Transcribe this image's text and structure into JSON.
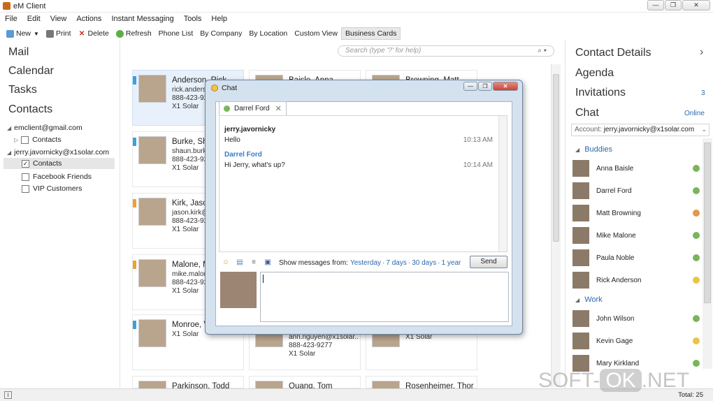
{
  "window": {
    "title": "eM Client",
    "min": "—",
    "max": "❐",
    "close": "✕"
  },
  "menu": [
    "File",
    "Edit",
    "View",
    "Actions",
    "Instant Messaging",
    "Tools",
    "Help"
  ],
  "toolbar": {
    "new": "New",
    "print": "Print",
    "delete": "Delete",
    "refresh": "Refresh",
    "views": [
      "Phone List",
      "By Company",
      "By Location",
      "Custom View",
      "Business Cards"
    ],
    "active_view": "Business Cards"
  },
  "nav": {
    "sections": [
      "Mail",
      "Calendar",
      "Tasks",
      "Contacts"
    ],
    "accounts": [
      {
        "name": "emclient@gmail.com",
        "folders": [
          "Contacts"
        ]
      },
      {
        "name": "jerry.javornicky@x1solar.com",
        "folders": [
          "Contacts",
          "Facebook Friends",
          "VIP Customers"
        ]
      }
    ]
  },
  "search": {
    "placeholder": "Search (type '?' for help)"
  },
  "cards": [
    {
      "name": "Anderson, Rick",
      "email": "rick.anderson@x1solar.com",
      "phone": "888-423-9277",
      "company": "X1 Solar",
      "bar": "#3aa0e0"
    },
    {
      "name": "Baisle, Anna",
      "email": "",
      "phone": "",
      "company": "",
      "bar": ""
    },
    {
      "name": "Browning, Matt",
      "email": "",
      "phone": "",
      "company": "",
      "bar": ""
    },
    {
      "name": "Burke, Shaun",
      "email": "shaun.burke@x1solar.com",
      "phone": "888-423-9277",
      "company": "X1 Solar",
      "bar": "#3aa0e0"
    },
    {
      "name": "Kirk, Jason",
      "email": "jason.kirk@x1solar.com",
      "phone": "888-423-9277",
      "company": "X1 Solar",
      "bar": "#f0a030"
    },
    {
      "name": "Malone, Mike",
      "email": "mike.malone@x1solar.com",
      "phone": "888-423-9277",
      "company": "X1 Solar",
      "bar": "#f0a030"
    },
    {
      "name": "Monroe, V",
      "email": "",
      "phone": "",
      "company": "X1 Solar",
      "bar": "#3aa0e0"
    },
    {
      "name": "",
      "email": "ann.nguyen@x1solar...",
      "phone": "888-423-9277",
      "company": "X1 Solar",
      "bar": ""
    },
    {
      "name": "",
      "email": "",
      "phone": "",
      "company": "X1 Solar",
      "bar": ""
    },
    {
      "name": "Parkinson, Todd",
      "email": "",
      "phone": "",
      "company": "",
      "bar": ""
    },
    {
      "name": "Quang, Tom",
      "email": "",
      "phone": "",
      "company": "",
      "bar": ""
    },
    {
      "name": "Rosenheimer, Thor",
      "email": "",
      "phone": "",
      "company": "",
      "bar": ""
    }
  ],
  "right": {
    "contact_details": "Contact Details",
    "agenda": "Agenda",
    "invitations": "Invitations",
    "invitations_count": "3",
    "chat": "Chat",
    "chat_status": "Online",
    "account_label": "Account:",
    "account_value": "jerry.javornicky@x1solar.com",
    "groups": [
      {
        "name": "Buddies",
        "members": [
          {
            "name": "Anna Baisle",
            "status": "#7ab55a"
          },
          {
            "name": "Darrel Ford",
            "status": "#7ab55a"
          },
          {
            "name": "Matt Browning",
            "status": "#e8944a"
          },
          {
            "name": "Mike Malone",
            "status": "#7ab55a"
          },
          {
            "name": "Paula Noble",
            "status": "#7ab55a"
          },
          {
            "name": "Rick Anderson",
            "status": "#e8c44a"
          }
        ]
      },
      {
        "name": "Work",
        "members": [
          {
            "name": "John Wilson",
            "status": "#7ab55a"
          },
          {
            "name": "Kevin Gage",
            "status": "#e8c44a"
          },
          {
            "name": "Mary Kirkland",
            "status": "#7ab55a"
          }
        ]
      }
    ]
  },
  "chat_window": {
    "title": "Chat",
    "tab": "Darrel Ford",
    "messages": [
      {
        "sender": "jerry.javornicky",
        "text": "Hello",
        "time": "10:13 AM",
        "color": "#222222"
      },
      {
        "sender": "Darrel Ford",
        "text": "Hi Jerry, what's up?",
        "time": "10:14 AM",
        "color": "#3a7ac8"
      }
    ],
    "show_label": "Show messages from:",
    "ranges": [
      "Yesterday",
      "7 days",
      "30 days",
      "1 year"
    ],
    "send": "Send"
  },
  "status": {
    "total": "Total: 25"
  },
  "watermark": {
    "left": "SOFT-",
    "ok": "OK",
    "right": ".NET"
  }
}
